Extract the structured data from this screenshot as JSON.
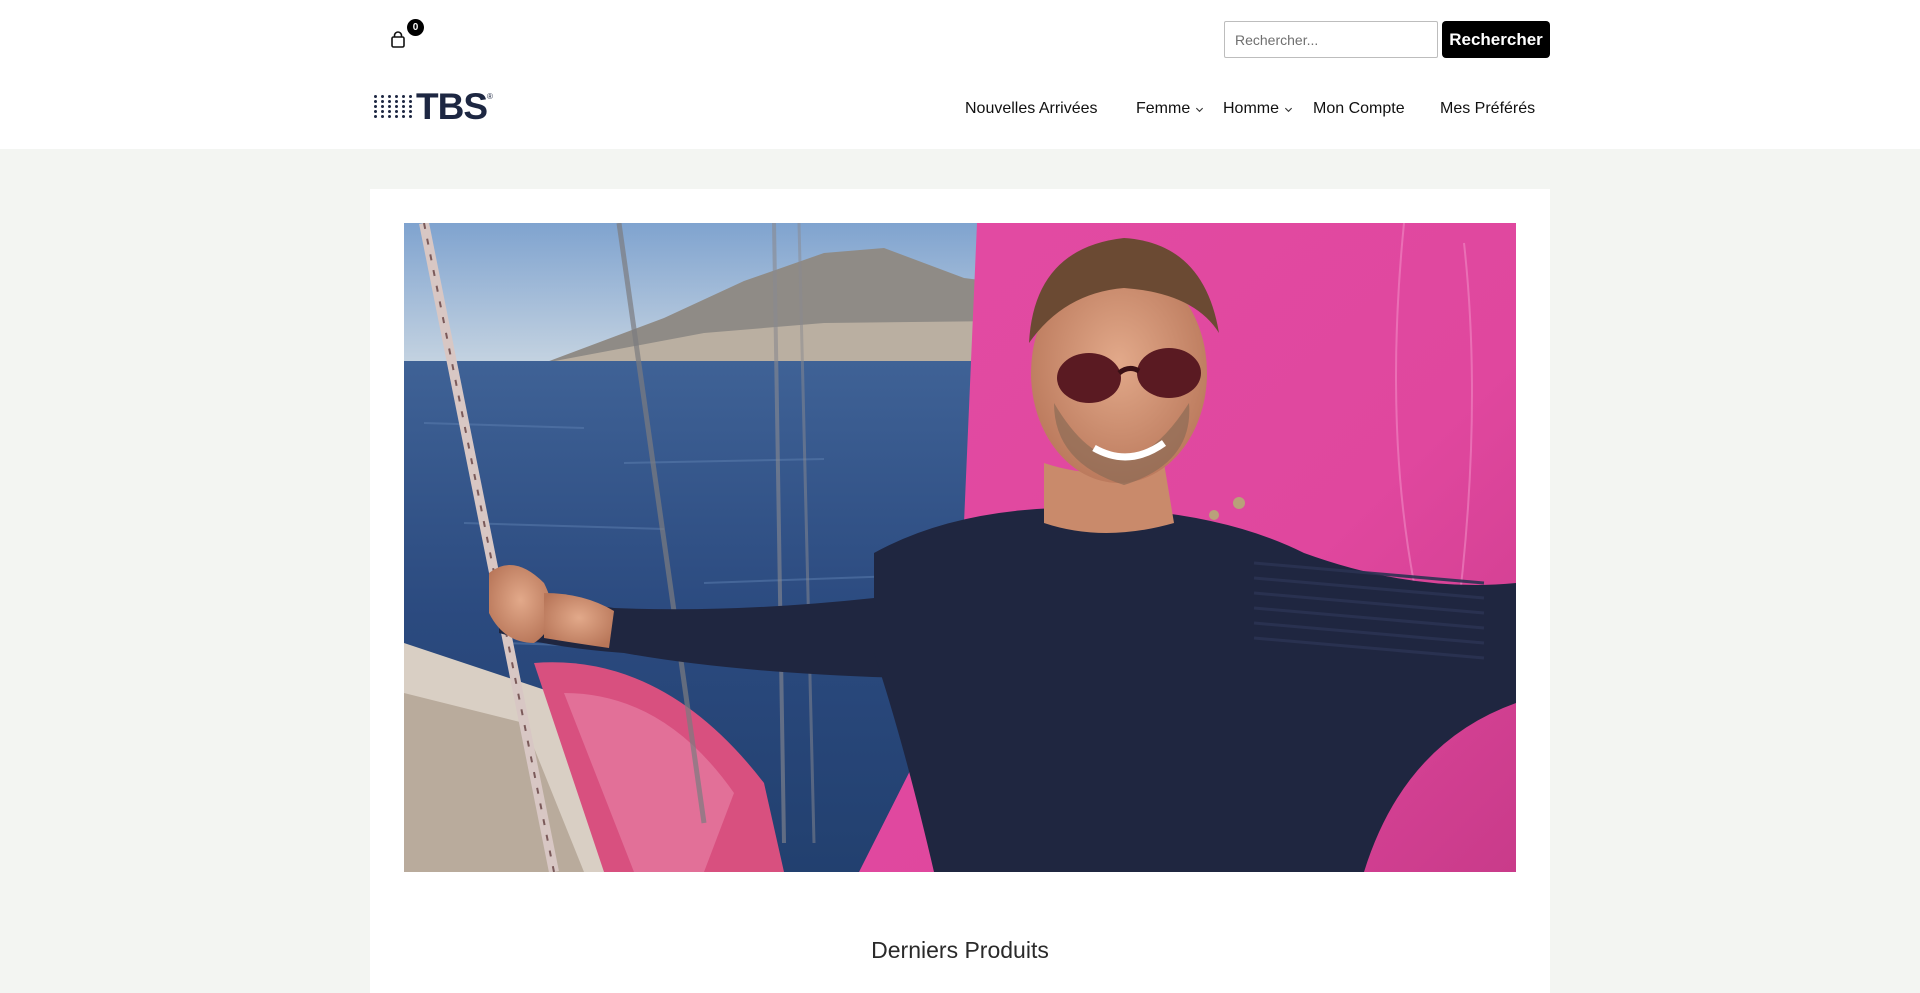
{
  "header": {
    "cart": {
      "count": "0",
      "icon": "shopping-bag-icon"
    },
    "search": {
      "placeholder": "Rechercher...",
      "value": "",
      "button_label": "Rechercher"
    },
    "logo": {
      "text": "TBS",
      "mark": "®"
    },
    "nav": {
      "items": [
        {
          "label": "Nouvelles Arrivées",
          "has_dropdown": false
        },
        {
          "label": "Femme",
          "has_dropdown": true
        },
        {
          "label": "Homme",
          "has_dropdown": true
        },
        {
          "label": "Mon Compte",
          "has_dropdown": false
        },
        {
          "label": "Mes Préférés",
          "has_dropdown": false
        }
      ]
    }
  },
  "main": {
    "hero_image": {
      "alt_icon": "hero-photo"
    },
    "section_title": "Derniers Produits"
  },
  "colors": {
    "page_background": "#f3f5f2",
    "brand_navy": "#1d2742",
    "button_black": "#000000",
    "sea_blue": "#2d4f86",
    "sail_pink": "#e0479e"
  }
}
